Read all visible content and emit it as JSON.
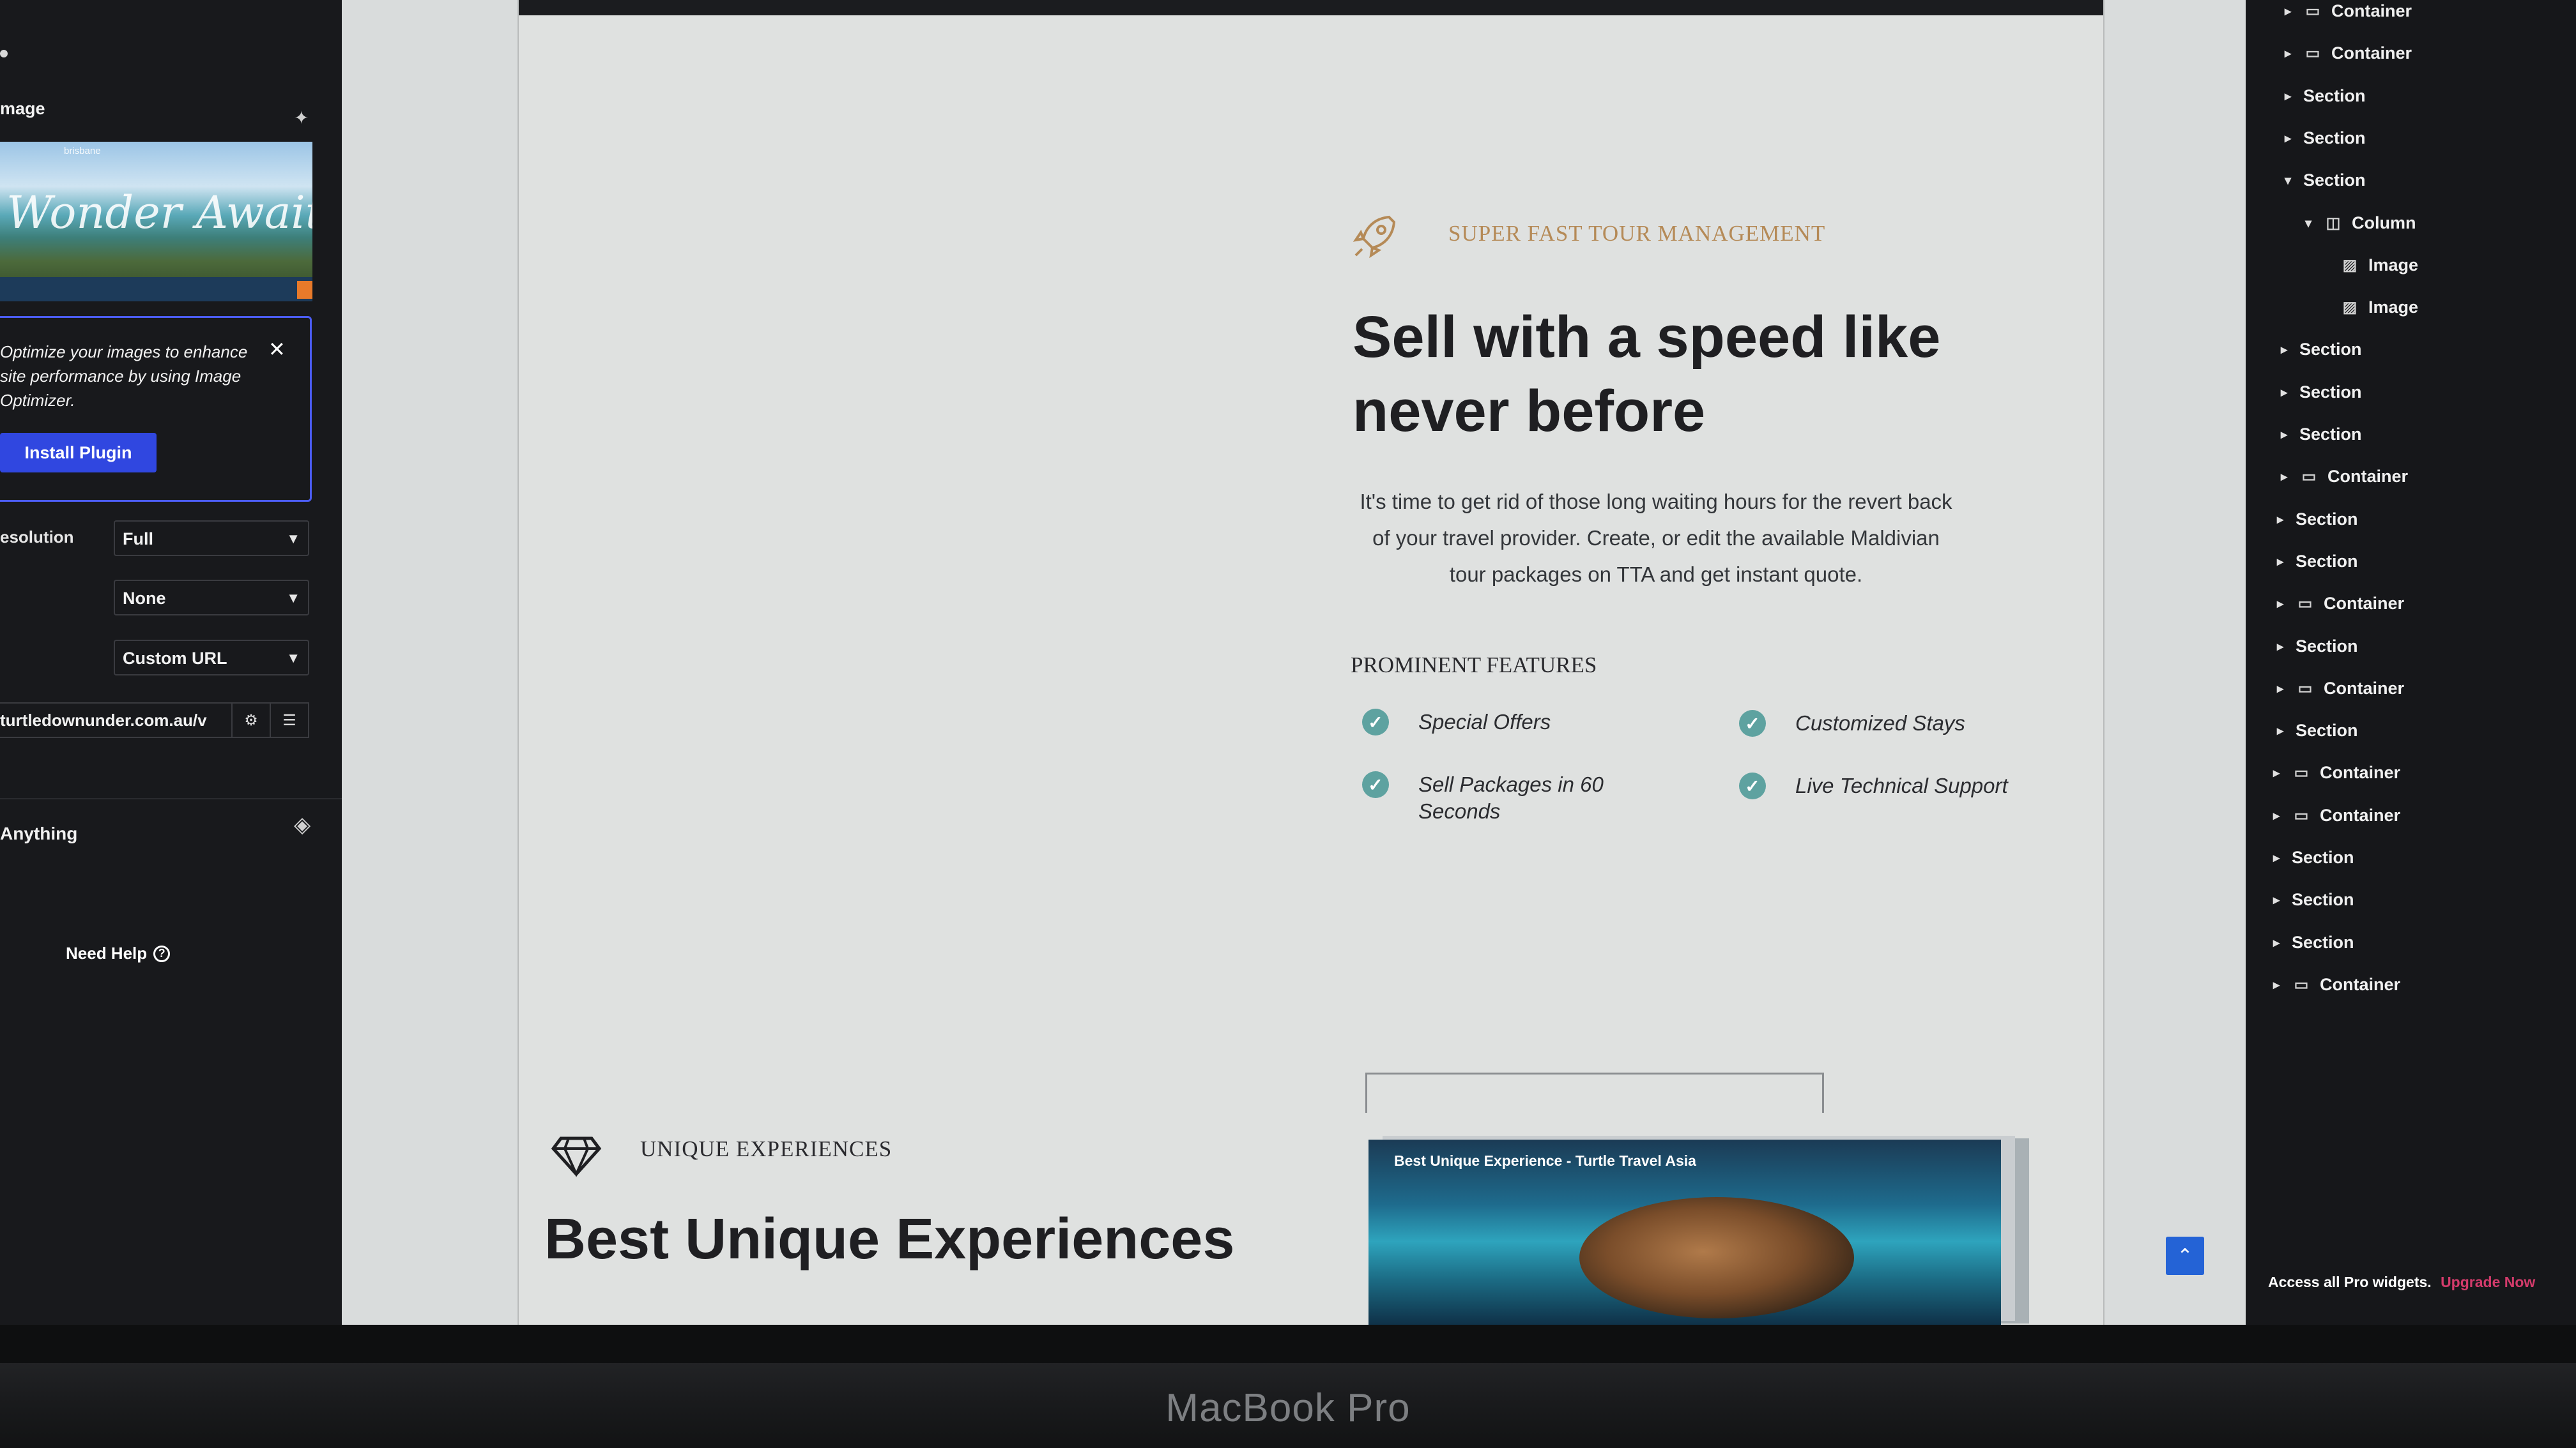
{
  "left_panel": {
    "section_title": "mage",
    "image_preview": {
      "brand": "brisbane",
      "script_text": "Wonder Awaits"
    },
    "optimizer_notice": {
      "text": "Optimize your images to enhance site performance by using Image Optimizer.",
      "button_label": "Install Plugin"
    },
    "fields": {
      "resolution_label": "esolution",
      "resolution_value": "Full",
      "second_value": "None",
      "link_value": "Custom URL",
      "url_value": "turtledownunder.com.au/v"
    },
    "anything_label": "Anything",
    "need_help_label": "Need Help",
    "help_glyph": "?",
    "collapse_glyph": "‹"
  },
  "canvas": {
    "feature_section": {
      "eyebrow": "SUPER FAST TOUR MANAGEMENT",
      "heading": "Sell with a speed like never before",
      "description": "It's time to get rid of those long waiting hours for the revert back of your travel provider. Create, or edit the available Maldivian tour packages on TTA and get instant quote.",
      "features_label": "PROMINENT FEATURES",
      "features": [
        "Special Offers",
        "Customized Stays",
        "Sell Packages in 60 Seconds",
        "Live Technical Support"
      ],
      "check_glyph": "✓"
    },
    "unique_section": {
      "eyebrow": "UNIQUE EXPERIENCES",
      "heading": "Best Unique Experiences",
      "video_title": "Best Unique Experience - Turtle Travel Asia"
    },
    "scroll_top_glyph": "⌃",
    "accent_color": "#b58a57",
    "check_color": "#5ea2a0"
  },
  "navigator": {
    "items": [
      {
        "label": "Container",
        "caret": "▸",
        "glyph": "▭"
      },
      {
        "label": "Container",
        "caret": "▸",
        "glyph": "▭"
      },
      {
        "label": "Section",
        "caret": "▸",
        "glyph": ""
      },
      {
        "label": "Section",
        "caret": "▸",
        "glyph": ""
      },
      {
        "label": "Section",
        "caret": "▾",
        "glyph": ""
      },
      {
        "label": "Column",
        "caret": "▾",
        "glyph": "◫"
      },
      {
        "label": "Image",
        "caret": "",
        "glyph": "▨"
      },
      {
        "label": "Image",
        "caret": "",
        "glyph": "▨"
      },
      {
        "label": "Section",
        "caret": "▸",
        "glyph": ""
      },
      {
        "label": "Section",
        "caret": "▸",
        "glyph": ""
      },
      {
        "label": "Section",
        "caret": "▸",
        "glyph": ""
      },
      {
        "label": "Container",
        "caret": "▸",
        "glyph": "▭"
      },
      {
        "label": "Section",
        "caret": "▸",
        "glyph": ""
      },
      {
        "label": "Section",
        "caret": "▸",
        "glyph": ""
      },
      {
        "label": "Container",
        "caret": "▸",
        "glyph": "▭"
      },
      {
        "label": "Section",
        "caret": "▸",
        "glyph": ""
      },
      {
        "label": "Container",
        "caret": "▸",
        "glyph": "▭"
      },
      {
        "label": "Section",
        "caret": "▸",
        "glyph": ""
      },
      {
        "label": "Container",
        "caret": "▸",
        "glyph": "▭"
      },
      {
        "label": "Container",
        "caret": "▸",
        "glyph": "▭"
      },
      {
        "label": "Section",
        "caret": "▸",
        "glyph": ""
      },
      {
        "label": "Section",
        "caret": "▸",
        "glyph": ""
      },
      {
        "label": "Section",
        "caret": "▸",
        "glyph": ""
      },
      {
        "label": "Container",
        "caret": "▸",
        "glyph": "▭"
      }
    ],
    "footer_text": "Access all Pro widgets.",
    "footer_link": "Upgrade Now"
  },
  "bezel": {
    "label": "MacBook Pro"
  }
}
